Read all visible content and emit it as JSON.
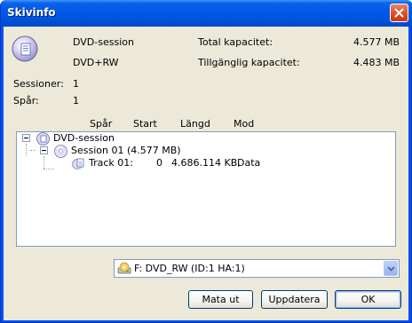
{
  "window": {
    "title": "Skivinfo"
  },
  "disc": {
    "type_label": "DVD-session",
    "media_label": "DVD+RW",
    "total_capacity_label": "Total kapacitet:",
    "total_capacity_value": "4.577 MB",
    "free_capacity_label": "Tillgänglig kapacitet:",
    "free_capacity_value": "4.483 MB",
    "sessions_label": "Sessioner:",
    "sessions_value": "1",
    "tracks_label": "Spår:",
    "tracks_value": "1"
  },
  "tree": {
    "columns": [
      "Spår",
      "Start",
      "Längd",
      "Mod"
    ],
    "root_label": "DVD-session",
    "session_label": "Session 01 (4.577 MB)",
    "track": {
      "name": "Track 01:",
      "start": "0",
      "length": "4.686.114 KB,",
      "mode": "Data"
    }
  },
  "drive_select": {
    "selected": "F: DVD_RW  (ID:1 HA:1)"
  },
  "buttons": {
    "eject": "Mata ut",
    "refresh": "Uppdatera",
    "ok": "OK"
  },
  "colors": {
    "titlebar": "#0055dd",
    "dialog_bg": "#ece9d8",
    "button_border": "#003c74"
  },
  "icons": {
    "disc": "dvd-disc-icon",
    "session": "cd-session-icon",
    "track": "track-file-icon",
    "drive": "drive-icon",
    "close": "close-icon",
    "dropdown": "chevron-down-icon"
  }
}
